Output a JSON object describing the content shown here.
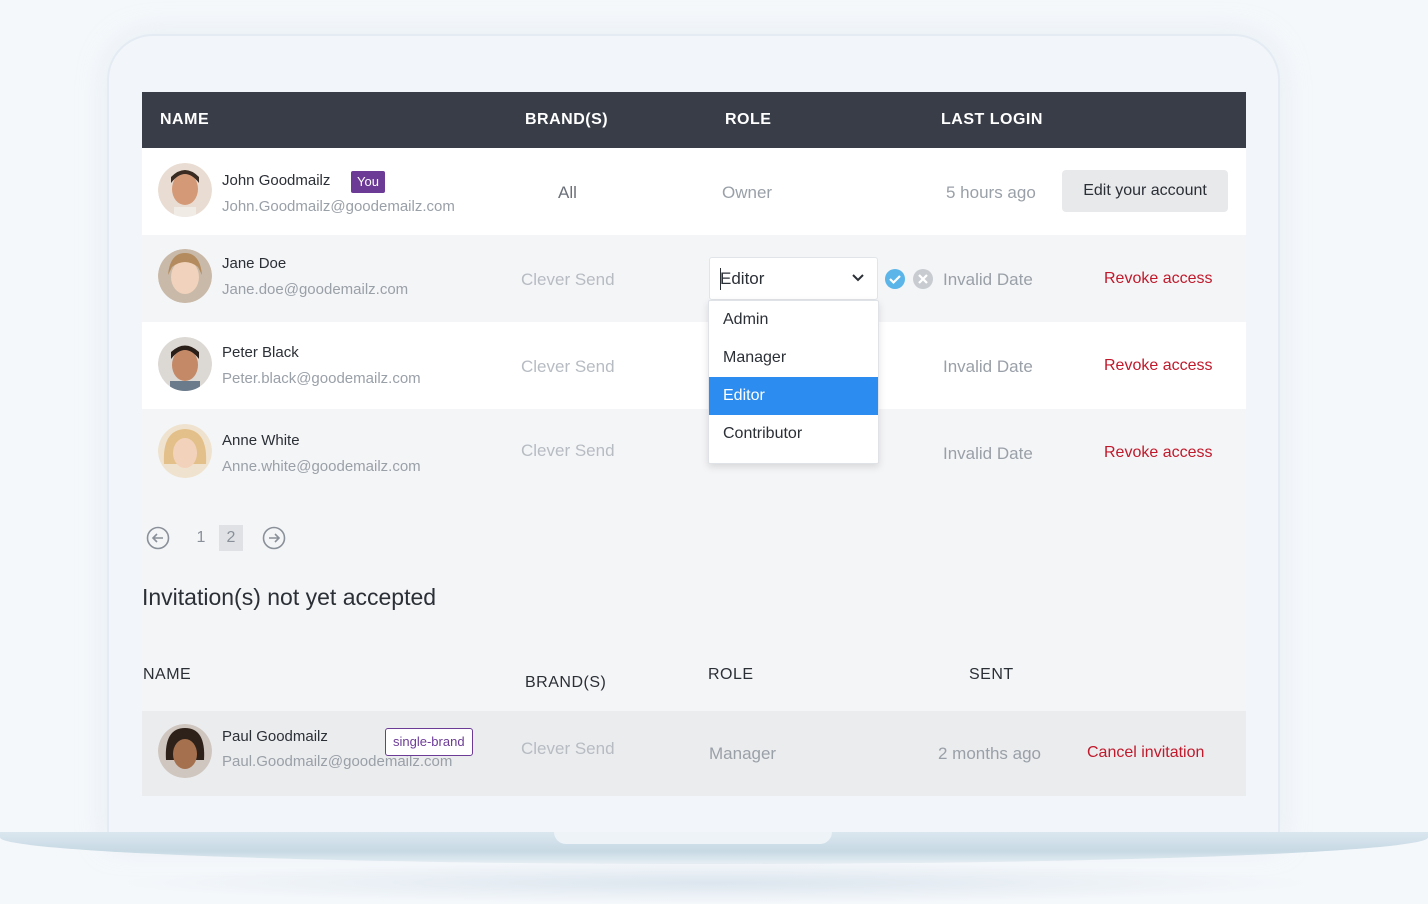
{
  "table": {
    "headers": {
      "name": "NAME",
      "brands": "BRAND(S)",
      "role": "ROLE",
      "last_login": "LAST LOGIN"
    },
    "users": [
      {
        "name": "John Goodmailz",
        "badge": "You",
        "email": "John.Goodmailz@goodemailz.com",
        "brand": "All",
        "role": "Owner",
        "last_login": "5 hours ago",
        "action": "Edit your account"
      },
      {
        "name": "Jane Doe",
        "email": "Jane.doe@goodemailz.com",
        "brand": "Clever Send",
        "role": "Editor",
        "last_login": "Invalid Date",
        "action": "Revoke access"
      },
      {
        "name": "Peter Black",
        "email": "Peter.black@goodemailz.com",
        "brand": "Clever Send",
        "last_login": "Invalid Date",
        "action": "Revoke access"
      },
      {
        "name": "Anne White",
        "email": "Anne.white@goodemailz.com",
        "brand": "Clever Send",
        "last_login": "Invalid Date",
        "action": "Revoke access"
      }
    ]
  },
  "role_dropdown": {
    "options": [
      "Admin",
      "Manager",
      "Editor",
      "Contributor"
    ],
    "selected": "Editor"
  },
  "pagination": {
    "pages": [
      "1",
      "2"
    ],
    "current": "2"
  },
  "invitations": {
    "title": "Invitation(s) not yet accepted",
    "headers": {
      "name": "NAME",
      "brands": "BRAND(S)",
      "role": "ROLE",
      "sent": "SENT"
    },
    "rows": [
      {
        "name": "Paul Goodmailz",
        "badge": "single-brand",
        "email": "Paul.Goodmailz@goodemailz.com",
        "brand": "Clever Send",
        "role": "Manager",
        "sent": "2 months ago",
        "action": "Cancel invitation"
      }
    ]
  },
  "colors": {
    "header_bg": "#383d48",
    "accent_purple": "#6c3b96",
    "danger_red": "#c0192b",
    "select_blue": "#2d8cf0",
    "confirm_blue": "#5bb5e8"
  }
}
